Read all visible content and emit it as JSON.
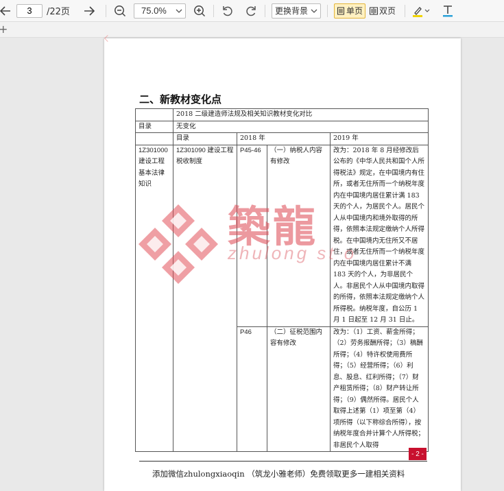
{
  "toolbar": {
    "page_current": "3",
    "page_total": "/22页",
    "zoom": "75.0%",
    "background_select": "更换背景",
    "single_page": "单页",
    "double_page": "双页"
  },
  "subbar": {
    "plus": "+"
  },
  "document": {
    "section_title": "二、新教材变化点",
    "table": {
      "caption": "2018 二级建造师法规及相关知识教材变化对比",
      "row_dir_label": "目录",
      "row_dir_value": "无变化",
      "headers": [
        "目录",
        "2018 年",
        "2019 年"
      ],
      "chapter": "1Z301000 建设工程基本法律知识",
      "section": "1Z301090 建设工程税收制度",
      "rows": [
        {
          "page": "P45-46",
          "item": "（一）纳税人内容有修改",
          "change": "改为：2018 年 8 月经修改后公布的《中华人民共和国个人所得税法》规定，在中国境内有住所，或者无住所而一个纳税年度内在中国境内居住累计满 183 天的个人，为居民个人。居民个人从中国境内和境外取得的所得，依照本法规定缴纳个人所得税。在中国境内无住所又不居住，或者无住所而一个纳税年度内在中国境内居住累计不满 183 天的个人，为非居民个人。非居民个人从中国境内取得的所得，依照本法规定缴纳个人所得税。纳税年度，自公历 1 月 1 日起至 12 月 31 日止。"
        },
        {
          "page": "P46",
          "item": "（二）征税范围内容有修改",
          "change": "改为：（1）工资、薪金所得；（2）劳务报酬所得；（3）稿酬所得；（4）特许权使用费所得；（5）经营所得；（6）利息、股息、红利所得；（7）财产租赁所得；（8）财产转让所得；（9）偶然所得。居民个人取得上述第（1）项至第（4）项所得（以下称综合所得），按纳税年度合并计算个人所得税；非居民个人取得"
        }
      ]
    },
    "watermark": {
      "main": "築龍",
      "sub": "zhulong st      o"
    },
    "page_number": "- 2 -",
    "footer": "添加微信zhulongxiaoqin （筑龙小雅老师）免费领取更多一建相关资料"
  },
  "colors": {
    "accent": "#f0b400",
    "watermark": "#dc4650",
    "page_badge": "#c8102e"
  }
}
